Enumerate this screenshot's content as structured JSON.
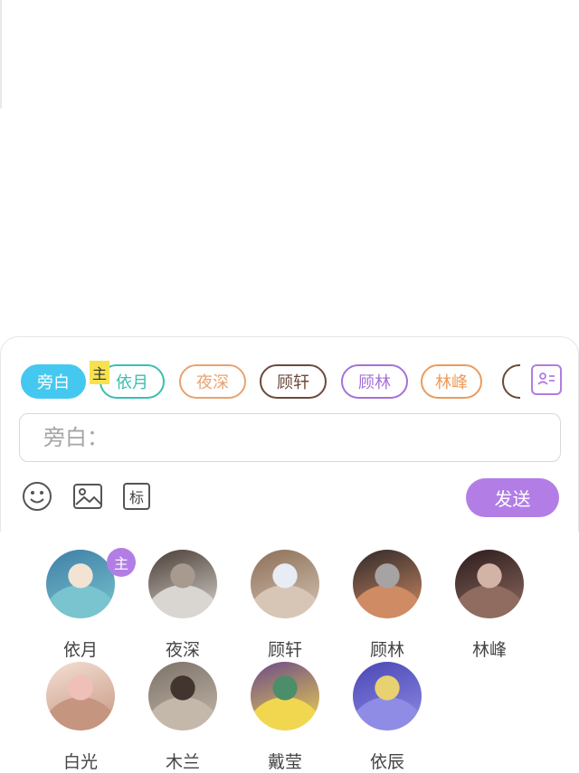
{
  "role_chips": [
    {
      "label": "旁白",
      "color": "#45c8f0",
      "active": true
    },
    {
      "label": "依月",
      "color": "#39bfb0",
      "active": false
    },
    {
      "label": "夜深",
      "color": "#e9a272",
      "active": false
    },
    {
      "label": "顾轩",
      "color": "#6b4a3a",
      "active": false
    },
    {
      "label": "顾林",
      "color": "#a671d8",
      "active": false
    },
    {
      "label": "林峰",
      "color": "#eb9b5c",
      "active": false
    }
  ],
  "chip_main_badge": "主",
  "input": {
    "placeholder": "旁白："
  },
  "tools": {
    "emoji": "emoji-icon",
    "image": "image-icon",
    "tag": "标"
  },
  "send_label": "发送",
  "roles": [
    {
      "name": "依月",
      "main": true,
      "badge": "主",
      "colors": [
        "#3f7fa6",
        "#79c4ce",
        "#f2e3d3"
      ]
    },
    {
      "name": "夜深",
      "main": false,
      "colors": [
        "#4b3e36",
        "#d9d6d1",
        "#a89a8e"
      ]
    },
    {
      "name": "顾轩",
      "main": false,
      "colors": [
        "#8c6f57",
        "#d7c6b6",
        "#e7ecf5"
      ]
    },
    {
      "name": "顾林",
      "main": false,
      "colors": [
        "#30292a",
        "#cf8b63",
        "#a6a3a3"
      ]
    },
    {
      "name": "林峰",
      "main": false,
      "colors": [
        "#2b1c1c",
        "#8f6b60",
        "#d3b3a6"
      ]
    },
    {
      "name": "白光",
      "main": false,
      "colors": [
        "#f3dfd3",
        "#c69580",
        "#f0c0b8"
      ]
    },
    {
      "name": "木兰",
      "main": false,
      "colors": [
        "#7d7268",
        "#c4b8ab",
        "#42352f"
      ]
    },
    {
      "name": "戴莹",
      "main": false,
      "colors": [
        "#6c4b88",
        "#f1d64f",
        "#4b8e69"
      ]
    },
    {
      "name": "依辰",
      "main": false,
      "colors": [
        "#4a47b5",
        "#8f8ce5",
        "#e7d170"
      ]
    }
  ]
}
